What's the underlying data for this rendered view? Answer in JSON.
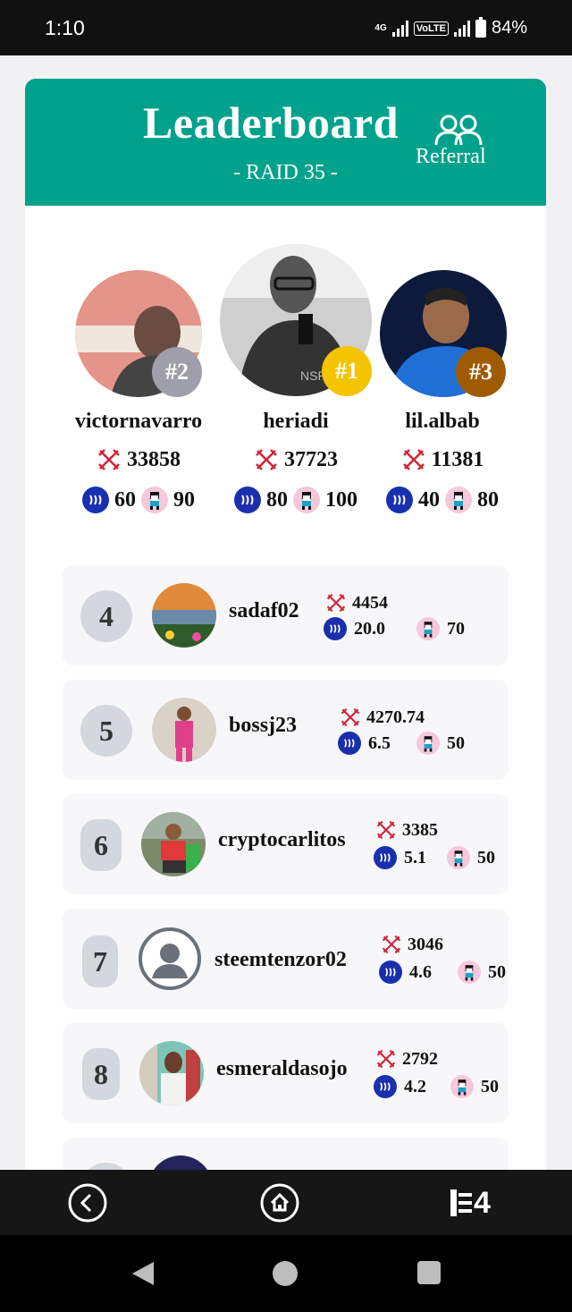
{
  "status_bar": {
    "time": "1:10",
    "net": "4G",
    "lte": "VoLTE",
    "battery": "84%"
  },
  "header": {
    "title": "Leaderboard",
    "subtitle": "- RAID 35 -",
    "referral_label": "Referral",
    "color": "#00a28c"
  },
  "podium": [
    {
      "rank": "#2",
      "name": "victornavarro",
      "score": "33858",
      "steem": "60",
      "pix": "90",
      "badge_color": "#9e9faa"
    },
    {
      "rank": "#1",
      "name": "heriadi",
      "score": "37723",
      "steem": "80",
      "pix": "100",
      "badge_color": "#f5c400"
    },
    {
      "rank": "#3",
      "name": "lil.albab",
      "score": "11381",
      "steem": "40",
      "pix": "80",
      "badge_color": "#a05a00"
    }
  ],
  "rows": [
    {
      "rank": "4",
      "name": "sadaf02",
      "score": "4454",
      "steem": "20.0",
      "pix": "70"
    },
    {
      "rank": "5",
      "name": "bossj23",
      "score": "4270.74",
      "steem": "6.5",
      "pix": "50"
    },
    {
      "rank": "6",
      "name": "cryptocarlitos",
      "score": "3385",
      "steem": "5.1",
      "pix": "50"
    },
    {
      "rank": "7",
      "name": "steemtenzor02",
      "score": "3046",
      "steem": "4.6",
      "pix": "50"
    },
    {
      "rank": "8",
      "name": "esmeraldasojo",
      "score": "2792",
      "steem": "4.2",
      "pix": "50"
    }
  ],
  "bottom_nav": {
    "back_icon": "back-circle-icon",
    "home_icon": "home-circle-icon",
    "brand_label": "4"
  }
}
